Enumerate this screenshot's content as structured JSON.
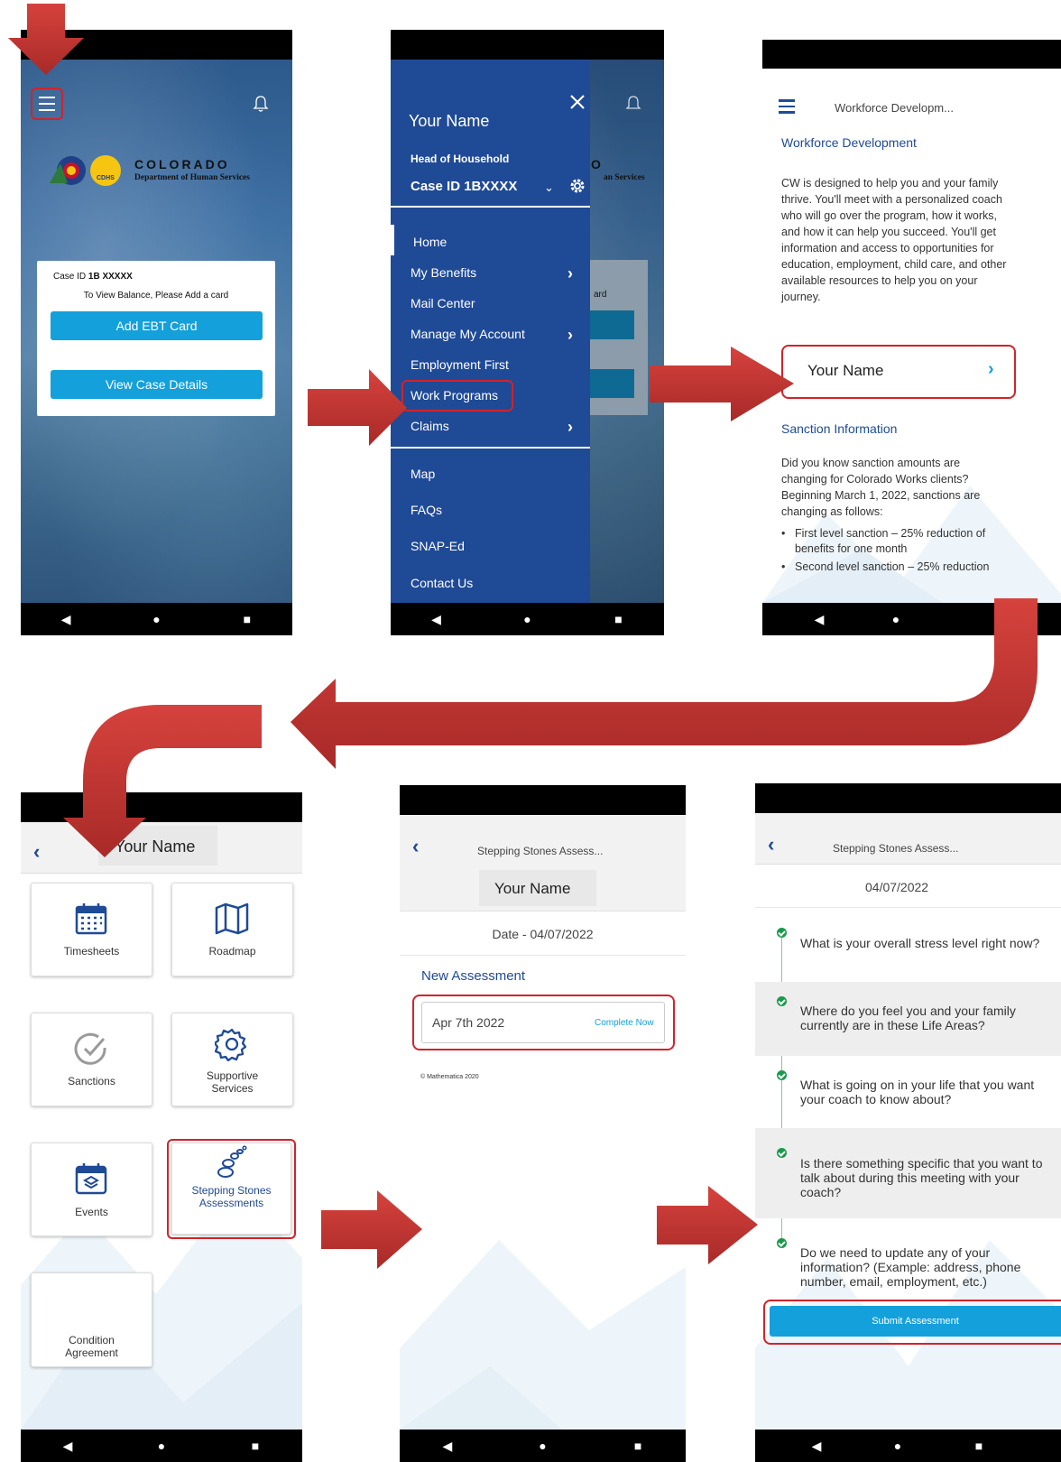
{
  "screen1": {
    "org_name": "COLORADO",
    "org_sub": "Department of Human Services",
    "logo_badge": "CDHS",
    "case_label": "Case ID ",
    "case_bold": "1B XXXXX",
    "balance_text": "To View Balance, Please Add a card",
    "add_card_label": "Add EBT Card",
    "view_case_label": "View Case Details"
  },
  "screen2": {
    "user_name": "Your Name",
    "role": "Head of Household",
    "case_id": "Case ID 1BXXXX",
    "partial_org": "O",
    "partial_org_sub": "an Services",
    "partial_card": "ard",
    "menu_main": [
      "Home",
      "My Benefits",
      "Mail Center",
      "Manage My Account",
      "Employment First",
      "Work Programs",
      "Claims"
    ],
    "menu_secondary": [
      "Map",
      "FAQs",
      "SNAP-Ed",
      "Contact Us"
    ]
  },
  "screen3": {
    "header_title": "Workforce Developm...",
    "section_title": "Workforce Development",
    "body": "CW is designed to help you and your family thrive. You'll meet with a personalized coach who will go over the program, how it works, and how it can help you succeed. You'll get information and access to opportunities for education, employment, child care, and other available resources to help you on your journey.",
    "name_button": "Your Name",
    "sanction_title": "Sanction Information",
    "sanction_body": "Did you know sanction amounts are changing for Colorado Works clients? Beginning March 1, 2022, sanctions are changing as follows:",
    "bullets": [
      "First level sanction – 25% reduction of benefits for one month",
      "Second level sanction – 25% reduction"
    ]
  },
  "screen4": {
    "header_title": "Your Name",
    "tiles": [
      "Timesheets",
      "Roadmap",
      "Sanctions",
      "Supportive Services",
      "Events",
      "Stepping Stones Assessments",
      "Condition Agreement"
    ]
  },
  "screen5": {
    "header_title": "Stepping Stones Assess...",
    "name": "Your Name",
    "date": "Date - 04/07/2022",
    "section": "New Assessment",
    "assessment_date": "Apr 7th 2022",
    "complete_now": "Complete Now",
    "footer": "© Mathematica 2020"
  },
  "screen6": {
    "header_title": "Stepping Stones Assess...",
    "date": "04/07/2022",
    "questions": [
      "What is your overall stress level right now?",
      "Where do you feel you and your family currently are in these Life Areas?",
      "What is going on in your life that you want your coach to know about?",
      "Is there something specific that you want to talk about during this meeting with your coach?",
      "Do we need to update any of your information? (Example: address, phone number, email, employment, etc.)"
    ],
    "submit_label": "Submit Assessment"
  },
  "colors": {
    "accent_blue": "#13a0db",
    "menu_blue": "#1f4a96",
    "highlight_red": "#d2232a",
    "arrow_red": "#c0312f",
    "check_green": "#1a9a4a"
  },
  "icons": [
    "hamburger-icon",
    "bell-icon",
    "close-icon",
    "gear-icon",
    "chevron-right-icon",
    "back-icon",
    "calendar-icon",
    "map-icon",
    "check-circle-icon",
    "events-icon",
    "bubbles-icon"
  ]
}
